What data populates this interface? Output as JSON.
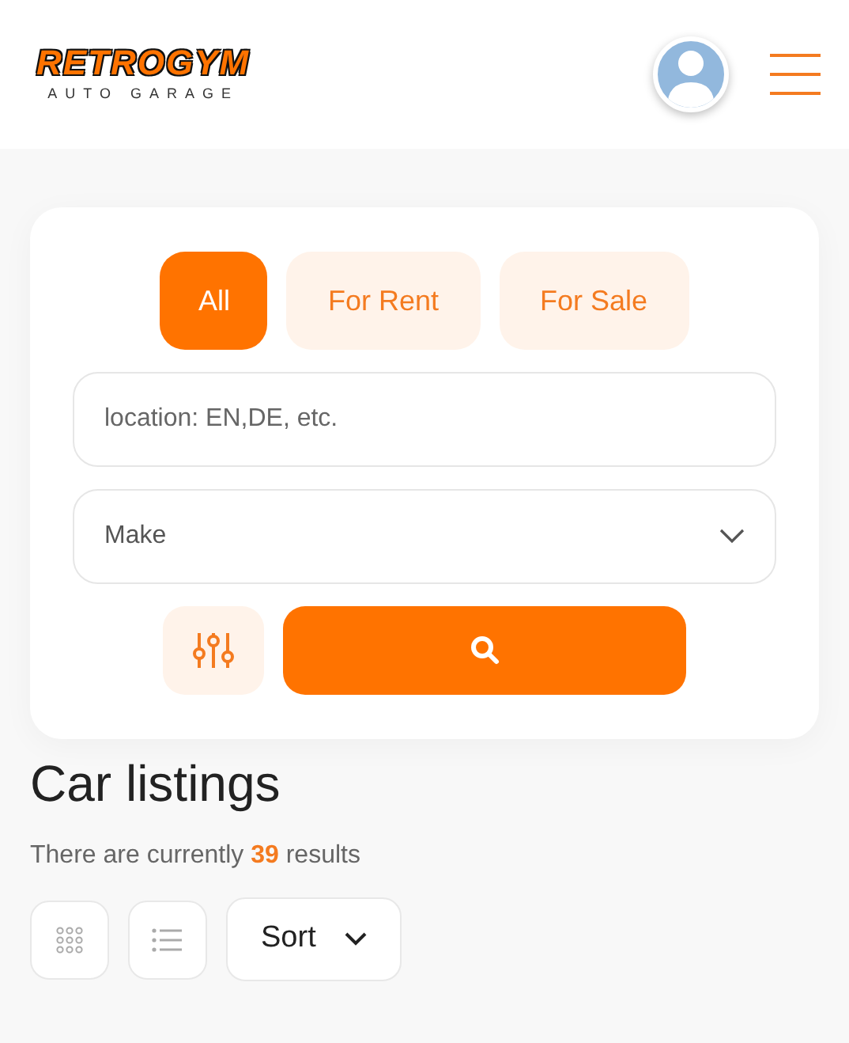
{
  "logo": {
    "title": "RETROGYM",
    "subtitle": "AUTO GARAGE"
  },
  "tabs": [
    {
      "label": "All",
      "selected": true
    },
    {
      "label": "For Rent",
      "selected": false
    },
    {
      "label": "For Sale",
      "selected": false
    }
  ],
  "location_field": {
    "placeholder": "location: EN,DE, etc."
  },
  "make_select": {
    "value": "Make"
  },
  "heading": "Car listings",
  "results_text": "There are currently **39** results",
  "view_buttons": [
    {
      "kind": "grid",
      "selected": false
    },
    {
      "kind": "list",
      "selected": false
    }
  ],
  "sort_button": {
    "label": "Sort"
  }
}
